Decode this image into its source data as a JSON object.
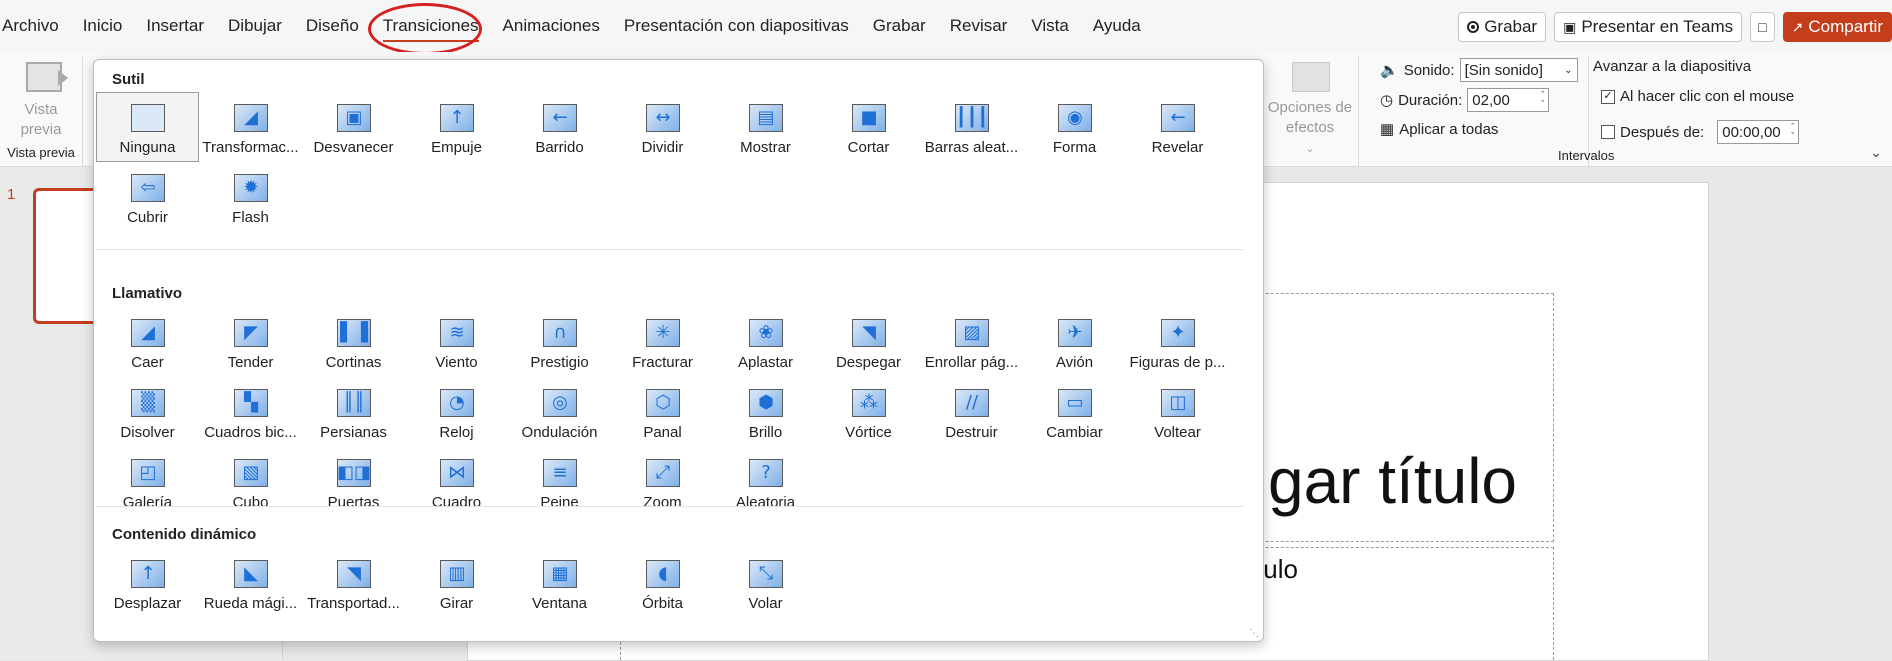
{
  "menubar": {
    "items": [
      "Archivo",
      "Inicio",
      "Insertar",
      "Dibujar",
      "Diseño",
      "Transiciones",
      "Animaciones",
      "Presentación con diapositivas",
      "Grabar",
      "Revisar",
      "Vista",
      "Ayuda"
    ],
    "active": "Transiciones",
    "record_label": "Grabar",
    "teams_label": "Presentar en Teams",
    "share_label": "Compartir",
    "accent_color": "#c43e1c"
  },
  "ribbon": {
    "preview_label": "Vista previa",
    "preview_group": "Vista previa",
    "effects_label": "Opciones de efectos",
    "sound_label": "Sonido:",
    "sound_value": "[Sin sonido]",
    "duration_label": "Duración:",
    "duration_value": "02,00",
    "apply_all_label": "Aplicar a todas",
    "advance_title": "Avanzar a la diapositiva",
    "on_click_label": "Al hacer clic con el mouse",
    "on_click_checked": true,
    "after_label": "Después de:",
    "after_checked": false,
    "after_value": "00:00,00",
    "timing_group": "Intervalos"
  },
  "slide": {
    "thumb_number": "1",
    "title_text": "gar título",
    "subtitle_text": "ulo"
  },
  "gallery": {
    "sections": [
      {
        "title": "Sutil",
        "items": [
          {
            "label": "Ninguna",
            "icon": "none-icon",
            "selected": true
          },
          {
            "label": "Transformac...",
            "icon": "morph-icon"
          },
          {
            "label": "Desvanecer",
            "icon": "fade-icon"
          },
          {
            "label": "Empuje",
            "icon": "push-icon"
          },
          {
            "label": "Barrido",
            "icon": "wipe-icon"
          },
          {
            "label": "Dividir",
            "icon": "split-icon"
          },
          {
            "label": "Mostrar",
            "icon": "reveal-icon"
          },
          {
            "label": "Cortar",
            "icon": "cut-icon"
          },
          {
            "label": "Barras aleat...",
            "icon": "random-bars-icon"
          },
          {
            "label": "Forma",
            "icon": "shape-icon"
          },
          {
            "label": "Revelar",
            "icon": "uncover-icon"
          },
          {
            "label": "Cubrir",
            "icon": "cover-icon"
          },
          {
            "label": "Flash",
            "icon": "flash-icon"
          }
        ]
      },
      {
        "title": "Llamativo",
        "items": [
          {
            "label": "Caer",
            "icon": "fall-icon"
          },
          {
            "label": "Tender",
            "icon": "drape-icon"
          },
          {
            "label": "Cortinas",
            "icon": "curtains-icon"
          },
          {
            "label": "Viento",
            "icon": "wind-icon"
          },
          {
            "label": "Prestigio",
            "icon": "prestige-icon"
          },
          {
            "label": "Fracturar",
            "icon": "fracture-icon"
          },
          {
            "label": "Aplastar",
            "icon": "crush-icon"
          },
          {
            "label": "Despegar",
            "icon": "peel-off-icon"
          },
          {
            "label": "Enrollar pág...",
            "icon": "page-curl-icon"
          },
          {
            "label": "Avión",
            "icon": "airplane-icon"
          },
          {
            "label": "Figuras de p...",
            "icon": "origami-icon"
          },
          {
            "label": "Disolver",
            "icon": "dissolve-icon"
          },
          {
            "label": "Cuadros bic...",
            "icon": "checkerboard-icon"
          },
          {
            "label": "Persianas",
            "icon": "blinds-icon"
          },
          {
            "label": "Reloj",
            "icon": "clock-icon"
          },
          {
            "label": "Ondulación",
            "icon": "ripple-icon"
          },
          {
            "label": "Panal",
            "icon": "honeycomb-icon"
          },
          {
            "label": "Brillo",
            "icon": "glitter-icon"
          },
          {
            "label": "Vórtice",
            "icon": "vortex-icon"
          },
          {
            "label": "Destruir",
            "icon": "shred-icon"
          },
          {
            "label": "Cambiar",
            "icon": "switch-icon"
          },
          {
            "label": "Voltear",
            "icon": "flip-icon"
          },
          {
            "label": "Galería",
            "icon": "gallery-icon"
          },
          {
            "label": "Cubo",
            "icon": "cube-icon"
          },
          {
            "label": "Puertas",
            "icon": "doors-icon"
          },
          {
            "label": "Cuadro",
            "icon": "box-icon"
          },
          {
            "label": "Peine",
            "icon": "comb-icon"
          },
          {
            "label": "Zoom",
            "icon": "zoom-icon"
          },
          {
            "label": "Aleatoria",
            "icon": "random-icon"
          }
        ]
      },
      {
        "title": "Contenido dinámico",
        "items": [
          {
            "label": "Desplazar",
            "icon": "pan-icon"
          },
          {
            "label": "Rueda mági...",
            "icon": "ferris-wheel-icon"
          },
          {
            "label": "Transportad...",
            "icon": "conveyor-icon"
          },
          {
            "label": "Girar",
            "icon": "rotate-icon"
          },
          {
            "label": "Ventana",
            "icon": "window-icon"
          },
          {
            "label": "Órbita",
            "icon": "orbit-icon"
          },
          {
            "label": "Volar",
            "icon": "fly-through-icon"
          }
        ]
      }
    ]
  }
}
